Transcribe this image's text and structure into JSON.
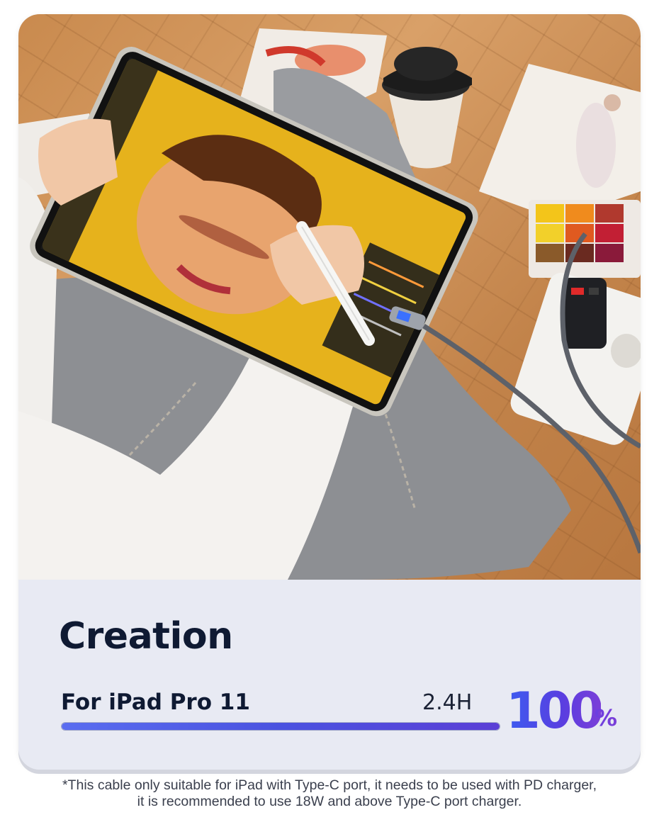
{
  "panel": {
    "title": "Creation",
    "device": "For iPad Pro 11",
    "charge_time": "2.4H",
    "charge_percent_value": "100",
    "charge_percent_unit": "%",
    "progress": 1.0
  },
  "footnote": {
    "line1": "*This cable only suitable for iPad with Type-C port, it needs to be used with PD charger,",
    "line2": "it is recommended to use 18W and above Type-C port charger."
  },
  "colors": {
    "title": "#0f1a33",
    "accent_gradient_start": "#3c5cf0",
    "accent_gradient_end": "#7b3fd8",
    "panel_bg": "#e8eaf3"
  }
}
